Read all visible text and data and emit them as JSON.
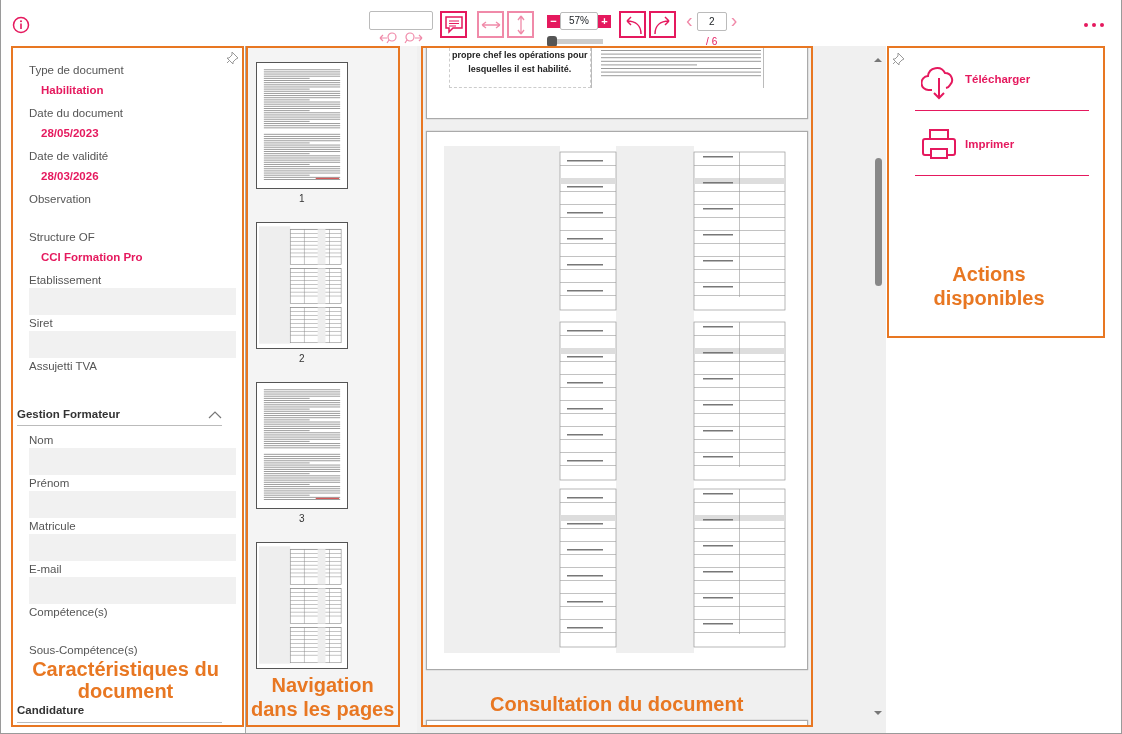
{
  "toolbar": {
    "zoom": {
      "minus": "−",
      "value": "57%",
      "plus": "+",
      "slider": {
        "level": 0
      }
    },
    "pager": {
      "prev": "‹",
      "page": "2",
      "total": "/ 6",
      "next": "›"
    }
  },
  "details": {
    "fields": [
      {
        "label": "Type de document",
        "kind": "value",
        "value": "Habilitation"
      },
      {
        "label": "Date du document",
        "kind": "value",
        "value": "28/05/2023"
      },
      {
        "label": "Date de validité",
        "kind": "value",
        "value": "28/03/2026"
      },
      {
        "label": "Observation",
        "kind": "blank"
      },
      {
        "label": "Structure OF",
        "kind": "value",
        "value": "CCI Formation Pro"
      },
      {
        "label": "Etablissement",
        "kind": "input"
      },
      {
        "label": "Siret",
        "kind": "input"
      },
      {
        "label": "Assujetti TVA",
        "kind": "blank"
      }
    ],
    "sections": [
      {
        "title": "Gestion Formateur",
        "expanded": true,
        "fields": [
          {
            "label": "Nom",
            "kind": "input"
          },
          {
            "label": "Prénom",
            "kind": "input"
          },
          {
            "label": "Matricule",
            "kind": "input"
          },
          {
            "label": "E-mail",
            "kind": "input"
          },
          {
            "label": "Compétence(s)",
            "kind": "blank"
          },
          {
            "label": "Sous-Compétence(s)",
            "kind": "label"
          }
        ]
      },
      {
        "title": "Candidature"
      }
    ]
  },
  "thumbnails": {
    "pages": [
      {
        "label": "1",
        "kind": "text"
      },
      {
        "label": "2",
        "kind": "table"
      },
      {
        "label": "3",
        "kind": "text"
      },
      {
        "kind": "table"
      }
    ]
  },
  "document": {
    "text": "propre chef les opérations pour lesquelles il est habilité."
  },
  "actions": [
    {
      "label": "Télécharger",
      "kind": "download"
    },
    {
      "label": "Imprimer",
      "kind": "print"
    }
  ],
  "annotations": [
    {
      "text": "Caractéristiques du document"
    },
    {
      "text": "Navigation dans les pages"
    },
    {
      "text": "Consultation du document"
    },
    {
      "text": "Actions disponibles"
    }
  ]
}
